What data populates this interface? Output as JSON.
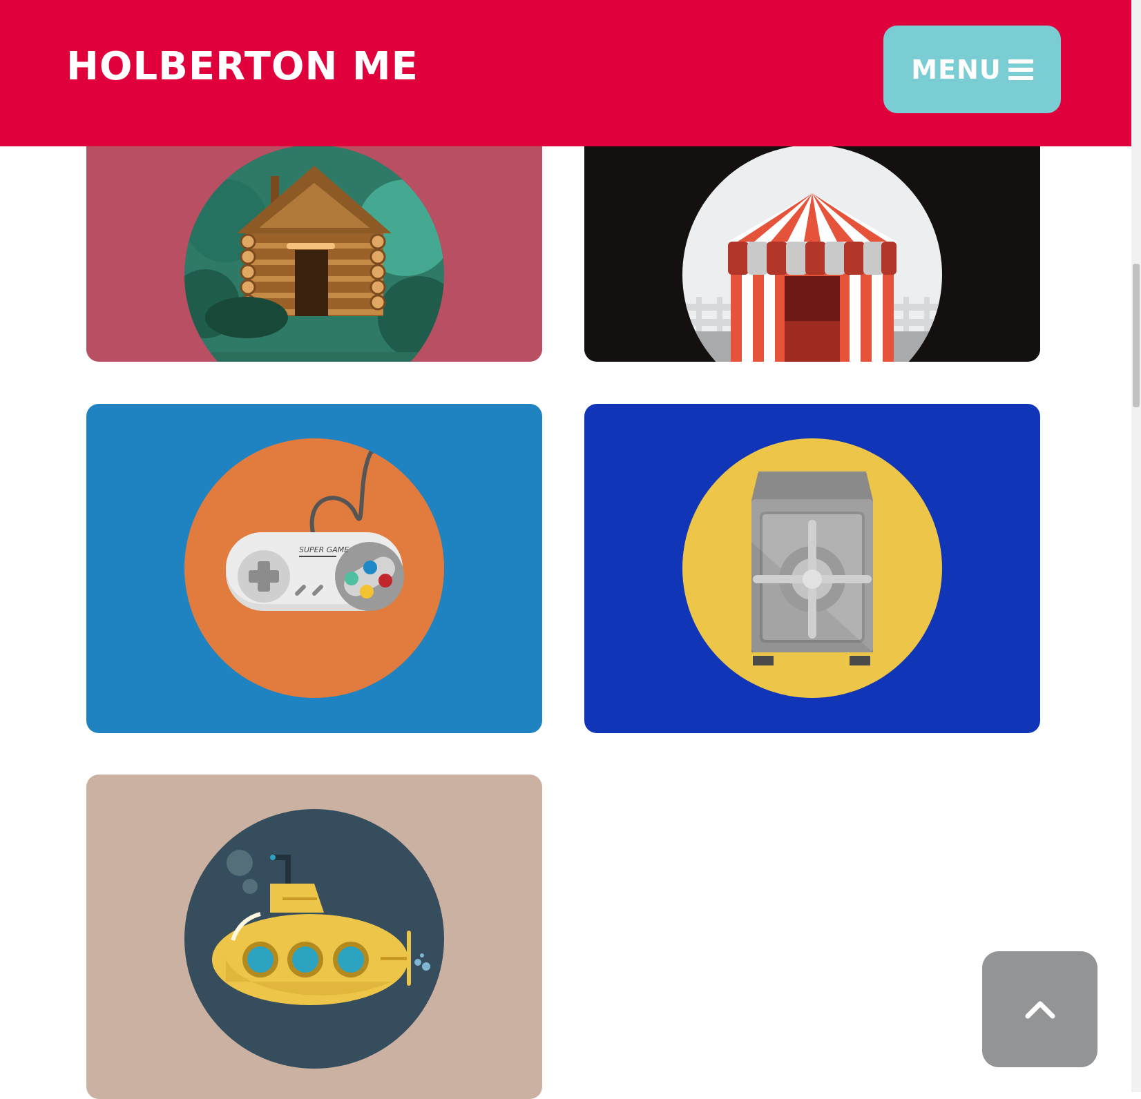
{
  "header": {
    "brand": "HOLBERTON ME",
    "menu_label": "MENU",
    "menu_icon": "hamburger-icon",
    "bg_color": "#e0003c",
    "menu_color": "#79cdd3"
  },
  "cards": [
    {
      "name": "log-cabin",
      "icon": "log-cabin-icon",
      "bg": "#b84f62"
    },
    {
      "name": "circus-tent",
      "icon": "circus-tent-icon",
      "bg": "#14100f"
    },
    {
      "name": "game-controller",
      "icon": "game-controller-icon",
      "bg": "#1f83c1",
      "controller_text": "SUPER GAME"
    },
    {
      "name": "safe",
      "icon": "safe-icon",
      "bg": "#1035b7"
    },
    {
      "name": "submarine",
      "icon": "submarine-icon",
      "bg": "#cbb1a2"
    }
  ],
  "back_to_top": {
    "icon": "chevron-up-icon"
  }
}
